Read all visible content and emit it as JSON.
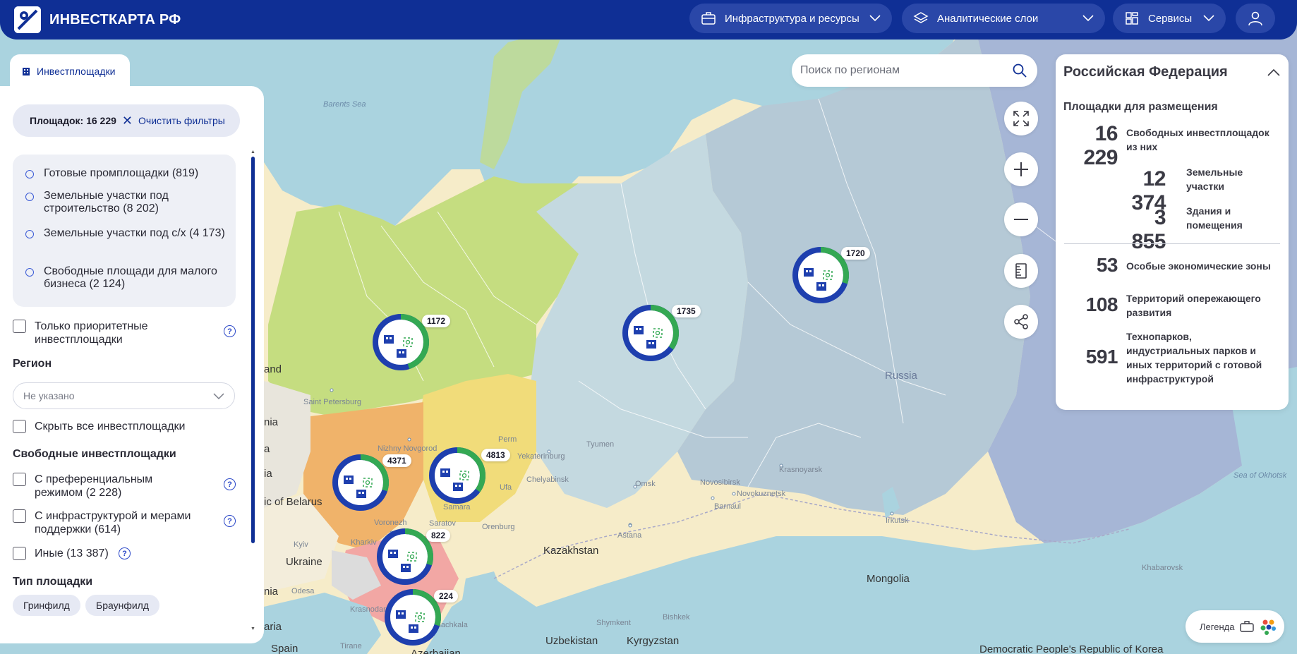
{
  "header": {
    "logo_text": "ИНВЕСТКАРТА РФ",
    "nav": [
      {
        "label": "Инфраструктура и ресурсы"
      },
      {
        "label": "Аналитические слои"
      },
      {
        "label": "Сервисы"
      }
    ]
  },
  "left_panel": {
    "tab_label": "Инвестплощадки",
    "filter_count": "Площадок: 16 229",
    "clear_label": "Очистить фильтры",
    "types": [
      {
        "label": "Готовые промплощадки (819)"
      },
      {
        "label": "Земельные участки под строительство (8 202)"
      },
      {
        "label": "Земельные участки под с/х (4 173)"
      },
      {
        "label": "Свободные площади для малого бизнеса (2 124)"
      }
    ],
    "priority_label": "Только приоритетные инвестплощадки",
    "region_title": "Регион",
    "region_placeholder": "Не указано",
    "hide_all_label": "Скрыть все инвестплощадки",
    "free_title": "Свободные инвестплощадки",
    "free_options": [
      {
        "label": "С преференциальным режимом (2 228)"
      },
      {
        "label": "С инфраструктурой и мерами поддержки (614)"
      },
      {
        "label": "Иные (13 387)"
      }
    ],
    "site_type_title": "Тип площадки",
    "site_types": [
      "Гринфилд",
      "Браунфилд"
    ]
  },
  "search": {
    "placeholder": "Поиск по регионам"
  },
  "info_panel": {
    "title": "Российская Федерация",
    "subtitle": "Площадки для размещения",
    "stats": [
      {
        "value": "16 229",
        "label": "Свободных инвестплощадок из них"
      },
      {
        "value": "12 374",
        "label": "Земельные участки"
      },
      {
        "value": "3 855",
        "label": "Здания и помещения"
      },
      {
        "value": "53",
        "label": "Особые экономические зоны"
      },
      {
        "value": "108",
        "label": "Территорий опережающего развития"
      },
      {
        "value": "591",
        "label": "Технопарков, индустриальных парков и иных территорий с готовой инфраструктурой"
      }
    ]
  },
  "legend": {
    "label": "Легенда"
  },
  "markers": [
    {
      "count": "1172",
      "green_share": 0.45
    },
    {
      "count": "1735",
      "green_share": 0.35
    },
    {
      "count": "1720",
      "green_share": 0.3
    },
    {
      "count": "4371",
      "green_share": 0.3
    },
    {
      "count": "4813",
      "green_share": 0.35
    },
    {
      "count": "822",
      "green_share": 0.3
    },
    {
      "count": "224",
      "green_share": 0.3
    }
  ],
  "map_labels": {
    "barents_sea": "Barents Sea",
    "russia": "Russia",
    "kazakhstan": "Kazakhstan",
    "mongolia": "Mongolia",
    "ukraine": "Ukraine",
    "uzbekistan": "Uzbekistan",
    "kyrgyzstan": "Kyrgyzstan",
    "belarus": "ic of Belarus",
    "sea_okhotsk": "Sea of Okhotsk",
    "dprk": "Democratic People's Republic of Korea",
    "azerbaijan": "Azerbaijan",
    "spain": "Spain",
    "finland": "and",
    "estonia": "nia",
    "latvia": "a",
    "lithuania": "ia",
    "romania": "nia",
    "bulgaria": "aria",
    "tirane": "Tirane",
    "cities": [
      "Saint Petersburg",
      "Nizhny Novgorod",
      "Perm",
      "Yekaterinburg",
      "Tyumen",
      "Chelyabinsk",
      "Ufa",
      "Samara",
      "Orenburg",
      "Saratov",
      "Voronezh",
      "Kharkiv",
      "Kyiv",
      "Odesa",
      "Krasnodar",
      "Makhachkala",
      "Astana",
      "Omsk",
      "Novosibirsk",
      "Novokuznetsk",
      "Barnaul",
      "Krasnoyarsk",
      "Irkutsk",
      "Khabarovsk",
      "Shymkent",
      "Bishkek"
    ]
  },
  "colors": {
    "primary": "#0f2f95",
    "accent_green": "#34a853",
    "marker_blue": "#1e3fae"
  }
}
